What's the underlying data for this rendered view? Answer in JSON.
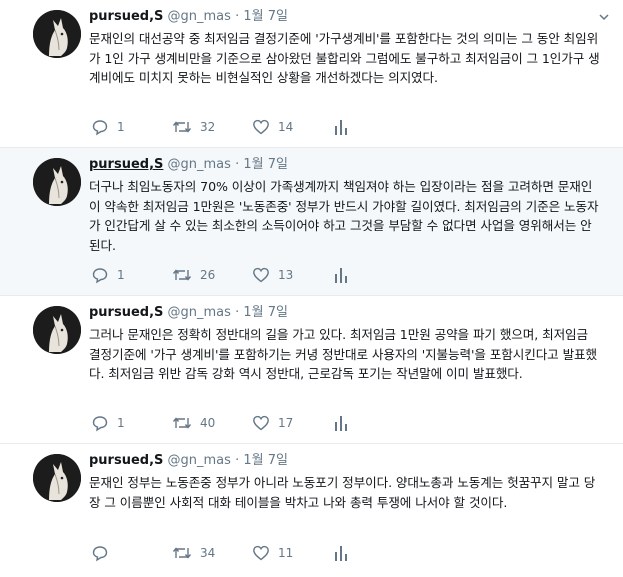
{
  "tweets": [
    {
      "name": "pursued,S",
      "handle": "@gn_mas",
      "time": "1월 7일",
      "text": "문재인의 대선공약 중 최저임금 결정기준에 '가구생계비'를 포함한다는 것의 의미는 그 동안 최임위가 1인 가구 생계비만을 기준으로 삼아왔던 불합리와 그럼에도 불구하고 최저임금이 그 1인가구 생계비에도 미치지 못하는 비현실적인 상황을 개선하겠다는 의지였다.",
      "replies": "1",
      "retweets": "32",
      "likes": "14"
    },
    {
      "name": "pursued,S",
      "handle": "@gn_mas",
      "time": "1월 7일",
      "text": "더구나 최임노동자의 70% 이상이 가족생계까지 책임져야 하는 입장이라는 점을 고려하면 문재인이 약속한 최저임금 1만원은 '노동존중' 정부가 반드시 가야할 길이였다. 최저임금의 기준은 노동자가 인간답게 살 수 있는 최소한의 소득이어야 하고 그것을 부담할 수 없다면 사업을 영위해서는 안된다.",
      "replies": "1",
      "retweets": "26",
      "likes": "13"
    },
    {
      "name": "pursued,S",
      "handle": "@gn_mas",
      "time": "1월 7일",
      "text": "그러나 문재인은 정확히 정반대의 길을 가고 있다. 최저임금 1만원 공약을 파기 했으며, 최저임금 결정기준에 '가구 생계비'를 포함하기는 커녕 정반대로 사용자의 '지불능력'을 포함시킨다고 발표했다. 최저임금 위반 감독 강화 역시 정반대, 근로감독 포기는 작년말에 이미 발표했다.",
      "replies": "1",
      "retweets": "40",
      "likes": "17"
    },
    {
      "name": "pursued,S",
      "handle": "@gn_mas",
      "time": "1월 7일",
      "text": "문재인 정부는 노동존중 정부가 아니라 노동포기 정부이다. 양대노총과 노동계는 헛꿈꾸지 말고 당장 그 이름뿐인 사회적 대화 테이블을 박차고 나와 총력 투쟁에 나서야 할 것이다.",
      "replies": "",
      "retweets": "34",
      "likes": "11"
    }
  ],
  "colors": {
    "text": "#14171a",
    "muted": "#657786",
    "highlight": "#f5f8fa",
    "border": "#e6ecf0"
  },
  "icons": [
    "avatar-horse",
    "reply-icon",
    "retweet-icon",
    "like-icon",
    "analytics-icon",
    "caret-down-icon"
  ]
}
